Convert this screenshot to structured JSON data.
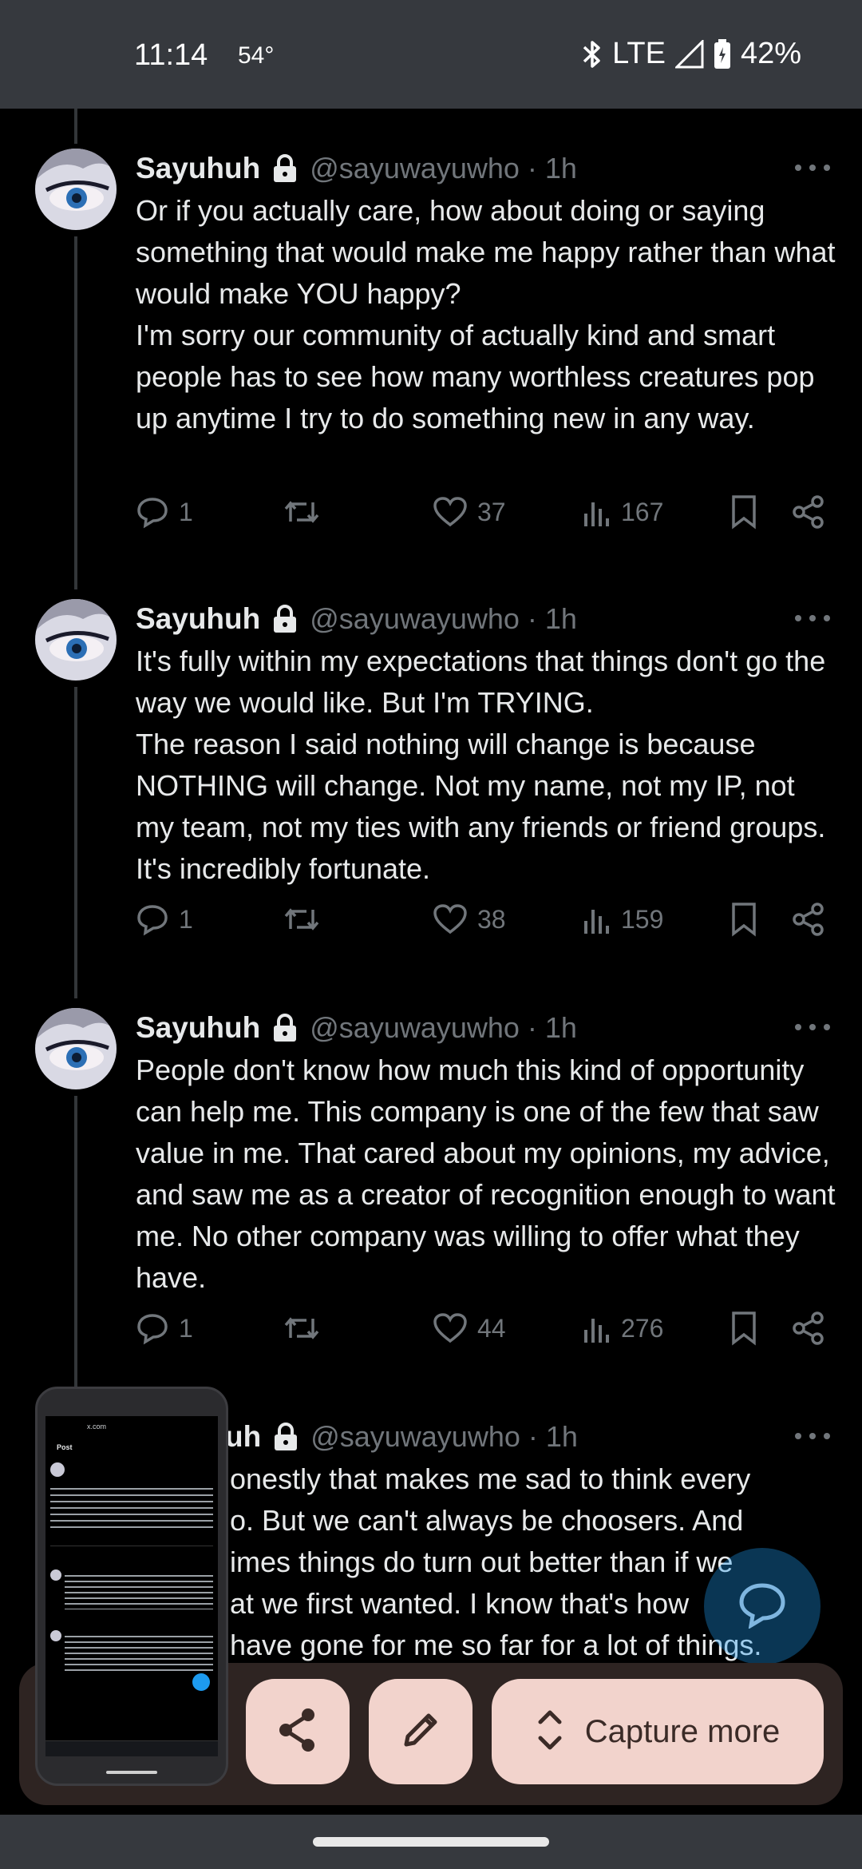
{
  "status_bar": {
    "time": "11:14",
    "temperature": "54°",
    "network": "LTE",
    "battery": "42%"
  },
  "tweets": [
    {
      "name": "Sayuhuh",
      "handle": "@sayuwayuwho · 1h",
      "text": "Or if you actually care, how about doing or saying something that would make me happy rather than what would make YOU happy?\nI'm sorry our community of actually kind and smart people has to see how many worthless creatures pop up anytime I try to do something new in any way.",
      "replies": "1",
      "likes": "37",
      "views": "167"
    },
    {
      "name": "Sayuhuh",
      "handle": "@sayuwayuwho · 1h",
      "text": "It's fully within my expectations that things don't go the way we would like. But I'm TRYING.\nThe reason I said nothing will change is because NOTHING will change. Not my name, not my IP, not my team, not my ties with any friends or friend groups. It's incredibly fortunate.",
      "replies": "1",
      "likes": "38",
      "views": "159"
    },
    {
      "name": "Sayuhuh",
      "handle": "@sayuwayuwho · 1h",
      "text": "People don't know how much this kind of opportunity can help me. This company is one of the few that saw value in me. That cared about my opinions, my advice, and saw me as a creator of recognition enough to want me. No other company was willing to offer what they have.",
      "replies": "1",
      "likes": "44",
      "views": "276"
    },
    {
      "name_partial": "uh",
      "handle": "@sayuwayuwho · 1h",
      "text_partial": "onestly that makes me sad to think every\no. But we can't always be choosers. And\nimes things do turn out better than if we\nat we first wanted. I know that's how\nhave gone for me so far for a lot of things."
    }
  ],
  "capture_toolbar": {
    "capture_more_label": "Capture more"
  },
  "thumbnail": {
    "url": "x.com",
    "title": "Post"
  },
  "colors": {
    "background": "#000000",
    "text": "#e7e9ea",
    "muted": "#71767b",
    "overlay": "#2e2422",
    "button": "#f2d3cc",
    "accent": "#1d9bf0"
  }
}
